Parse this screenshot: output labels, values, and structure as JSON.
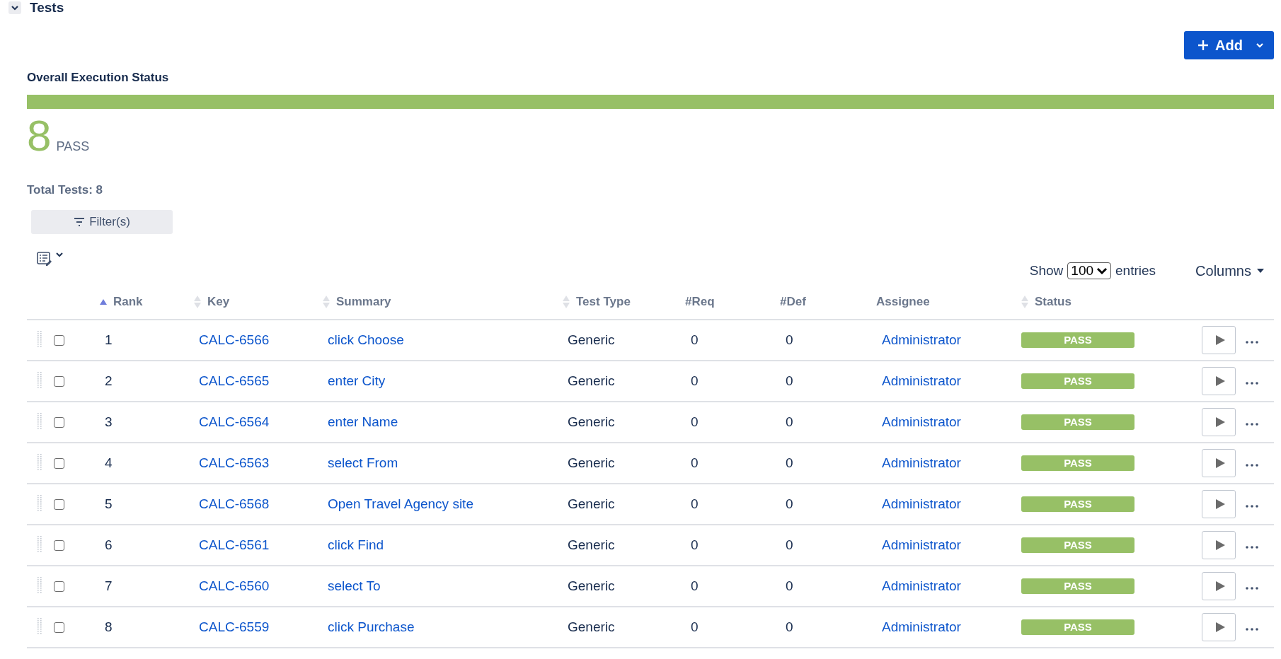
{
  "section": {
    "title": "Tests",
    "expanded": true
  },
  "add_button": {
    "label": "Add"
  },
  "execution_status": {
    "title": "Overall Execution Status",
    "count": "8",
    "count_label": "PASS"
  },
  "total_tests": "Total Tests: 8",
  "filter_button": {
    "label": "Filter(s)"
  },
  "page_length": {
    "show_label": "Show",
    "value": "100",
    "entries_label": "entries"
  },
  "columns_button": {
    "label": "Columns"
  },
  "table": {
    "columns": [
      {
        "label": "Rank",
        "sortable": true,
        "sorted_ascending": true
      },
      {
        "label": "Key",
        "sortable": true,
        "sorted_ascending": false
      },
      {
        "label": "Summary",
        "sortable": true,
        "sorted_ascending": false
      },
      {
        "label": "Test Type",
        "sortable": true,
        "sorted_ascending": false
      },
      {
        "label": "#Req",
        "sortable": false
      },
      {
        "label": "#Def",
        "sortable": false
      },
      {
        "label": "Assignee",
        "sortable": false
      },
      {
        "label": "Status",
        "sortable": true,
        "sorted_ascending": false
      }
    ],
    "rows": [
      {
        "checked": false,
        "rank": "1",
        "key": "CALC-6566",
        "summary": "click Choose",
        "test_type": "Generic",
        "req": "0",
        "def": "0",
        "assignee": "Administrator",
        "status": "PASS",
        "color": "#97c066"
      },
      {
        "checked": false,
        "rank": "2",
        "key": "CALC-6565",
        "summary": "enter City",
        "test_type": "Generic",
        "req": "0",
        "def": "0",
        "assignee": "Administrator",
        "status": "PASS",
        "color": "#97c066"
      },
      {
        "checked": false,
        "rank": "3",
        "key": "CALC-6564",
        "summary": "enter Name",
        "test_type": "Generic",
        "req": "0",
        "def": "0",
        "assignee": "Administrator",
        "status": "PASS",
        "color": "#97c066"
      },
      {
        "checked": false,
        "rank": "4",
        "key": "CALC-6563",
        "summary": "select From",
        "test_type": "Generic",
        "req": "0",
        "def": "0",
        "assignee": "Administrator",
        "status": "PASS",
        "color": "#97c066"
      },
      {
        "checked": false,
        "rank": "5",
        "key": "CALC-6568",
        "summary": "Open Travel Agency site",
        "test_type": "Generic",
        "req": "0",
        "def": "0",
        "assignee": "Administrator",
        "status": "PASS",
        "color": "#97c066"
      },
      {
        "checked": false,
        "rank": "6",
        "key": "CALC-6561",
        "summary": "click Find",
        "test_type": "Generic",
        "req": "0",
        "def": "0",
        "assignee": "Administrator",
        "status": "PASS",
        "color": "#97c066"
      },
      {
        "checked": false,
        "rank": "7",
        "key": "CALC-6560",
        "summary": "select To",
        "test_type": "Generic",
        "req": "0",
        "def": "0",
        "assignee": "Administrator",
        "status": "PASS",
        "color": "#97c066"
      },
      {
        "checked": false,
        "rank": "8",
        "key": "CALC-6559",
        "summary": "click Purchase",
        "test_type": "Generic",
        "req": "0",
        "def": "0",
        "assignee": "Administrator",
        "status": "PASS",
        "color": "#97c066"
      }
    ]
  }
}
